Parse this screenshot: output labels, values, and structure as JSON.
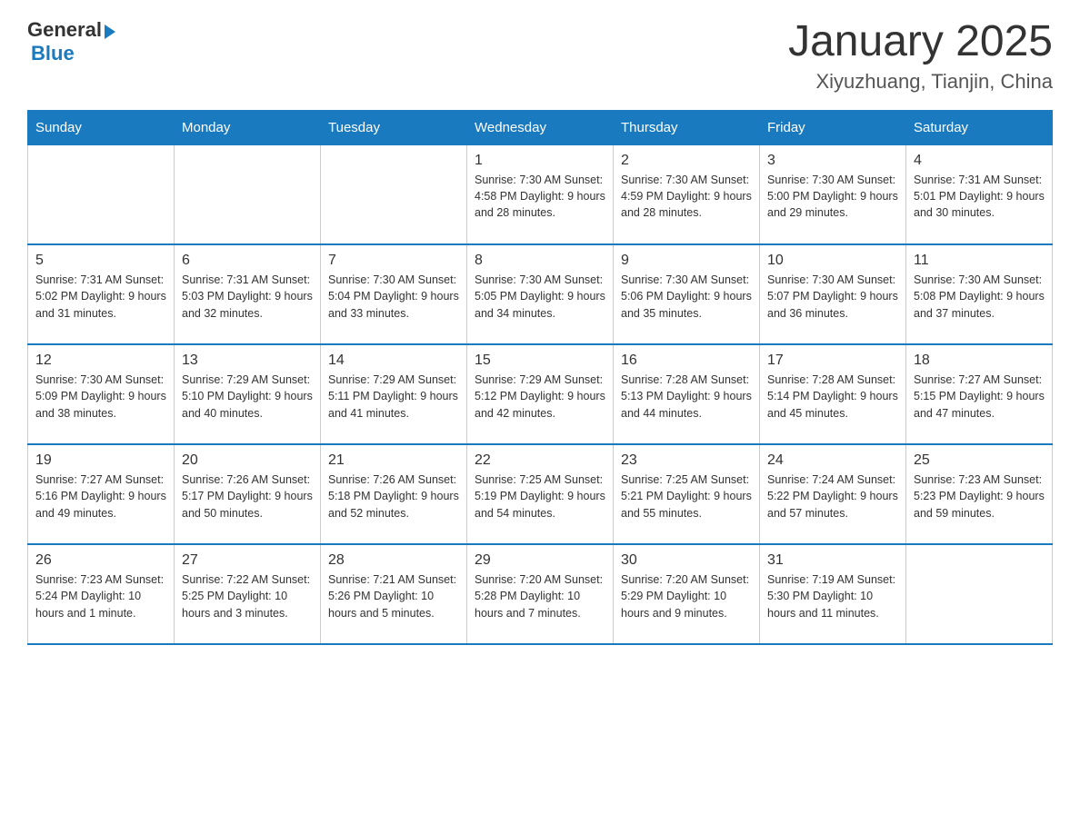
{
  "header": {
    "logo_general": "General",
    "logo_blue": "Blue",
    "title": "January 2025",
    "subtitle": "Xiyuzhuang, Tianjin, China"
  },
  "days_of_week": [
    "Sunday",
    "Monday",
    "Tuesday",
    "Wednesday",
    "Thursday",
    "Friday",
    "Saturday"
  ],
  "weeks": [
    [
      {
        "day": "",
        "info": ""
      },
      {
        "day": "",
        "info": ""
      },
      {
        "day": "",
        "info": ""
      },
      {
        "day": "1",
        "info": "Sunrise: 7:30 AM\nSunset: 4:58 PM\nDaylight: 9 hours\nand 28 minutes."
      },
      {
        "day": "2",
        "info": "Sunrise: 7:30 AM\nSunset: 4:59 PM\nDaylight: 9 hours\nand 28 minutes."
      },
      {
        "day": "3",
        "info": "Sunrise: 7:30 AM\nSunset: 5:00 PM\nDaylight: 9 hours\nand 29 minutes."
      },
      {
        "day": "4",
        "info": "Sunrise: 7:31 AM\nSunset: 5:01 PM\nDaylight: 9 hours\nand 30 minutes."
      }
    ],
    [
      {
        "day": "5",
        "info": "Sunrise: 7:31 AM\nSunset: 5:02 PM\nDaylight: 9 hours\nand 31 minutes."
      },
      {
        "day": "6",
        "info": "Sunrise: 7:31 AM\nSunset: 5:03 PM\nDaylight: 9 hours\nand 32 minutes."
      },
      {
        "day": "7",
        "info": "Sunrise: 7:30 AM\nSunset: 5:04 PM\nDaylight: 9 hours\nand 33 minutes."
      },
      {
        "day": "8",
        "info": "Sunrise: 7:30 AM\nSunset: 5:05 PM\nDaylight: 9 hours\nand 34 minutes."
      },
      {
        "day": "9",
        "info": "Sunrise: 7:30 AM\nSunset: 5:06 PM\nDaylight: 9 hours\nand 35 minutes."
      },
      {
        "day": "10",
        "info": "Sunrise: 7:30 AM\nSunset: 5:07 PM\nDaylight: 9 hours\nand 36 minutes."
      },
      {
        "day": "11",
        "info": "Sunrise: 7:30 AM\nSunset: 5:08 PM\nDaylight: 9 hours\nand 37 minutes."
      }
    ],
    [
      {
        "day": "12",
        "info": "Sunrise: 7:30 AM\nSunset: 5:09 PM\nDaylight: 9 hours\nand 38 minutes."
      },
      {
        "day": "13",
        "info": "Sunrise: 7:29 AM\nSunset: 5:10 PM\nDaylight: 9 hours\nand 40 minutes."
      },
      {
        "day": "14",
        "info": "Sunrise: 7:29 AM\nSunset: 5:11 PM\nDaylight: 9 hours\nand 41 minutes."
      },
      {
        "day": "15",
        "info": "Sunrise: 7:29 AM\nSunset: 5:12 PM\nDaylight: 9 hours\nand 42 minutes."
      },
      {
        "day": "16",
        "info": "Sunrise: 7:28 AM\nSunset: 5:13 PM\nDaylight: 9 hours\nand 44 minutes."
      },
      {
        "day": "17",
        "info": "Sunrise: 7:28 AM\nSunset: 5:14 PM\nDaylight: 9 hours\nand 45 minutes."
      },
      {
        "day": "18",
        "info": "Sunrise: 7:27 AM\nSunset: 5:15 PM\nDaylight: 9 hours\nand 47 minutes."
      }
    ],
    [
      {
        "day": "19",
        "info": "Sunrise: 7:27 AM\nSunset: 5:16 PM\nDaylight: 9 hours\nand 49 minutes."
      },
      {
        "day": "20",
        "info": "Sunrise: 7:26 AM\nSunset: 5:17 PM\nDaylight: 9 hours\nand 50 minutes."
      },
      {
        "day": "21",
        "info": "Sunrise: 7:26 AM\nSunset: 5:18 PM\nDaylight: 9 hours\nand 52 minutes."
      },
      {
        "day": "22",
        "info": "Sunrise: 7:25 AM\nSunset: 5:19 PM\nDaylight: 9 hours\nand 54 minutes."
      },
      {
        "day": "23",
        "info": "Sunrise: 7:25 AM\nSunset: 5:21 PM\nDaylight: 9 hours\nand 55 minutes."
      },
      {
        "day": "24",
        "info": "Sunrise: 7:24 AM\nSunset: 5:22 PM\nDaylight: 9 hours\nand 57 minutes."
      },
      {
        "day": "25",
        "info": "Sunrise: 7:23 AM\nSunset: 5:23 PM\nDaylight: 9 hours\nand 59 minutes."
      }
    ],
    [
      {
        "day": "26",
        "info": "Sunrise: 7:23 AM\nSunset: 5:24 PM\nDaylight: 10 hours\nand 1 minute."
      },
      {
        "day": "27",
        "info": "Sunrise: 7:22 AM\nSunset: 5:25 PM\nDaylight: 10 hours\nand 3 minutes."
      },
      {
        "day": "28",
        "info": "Sunrise: 7:21 AM\nSunset: 5:26 PM\nDaylight: 10 hours\nand 5 minutes."
      },
      {
        "day": "29",
        "info": "Sunrise: 7:20 AM\nSunset: 5:28 PM\nDaylight: 10 hours\nand 7 minutes."
      },
      {
        "day": "30",
        "info": "Sunrise: 7:20 AM\nSunset: 5:29 PM\nDaylight: 10 hours\nand 9 minutes."
      },
      {
        "day": "31",
        "info": "Sunrise: 7:19 AM\nSunset: 5:30 PM\nDaylight: 10 hours\nand 11 minutes."
      },
      {
        "day": "",
        "info": ""
      }
    ]
  ]
}
